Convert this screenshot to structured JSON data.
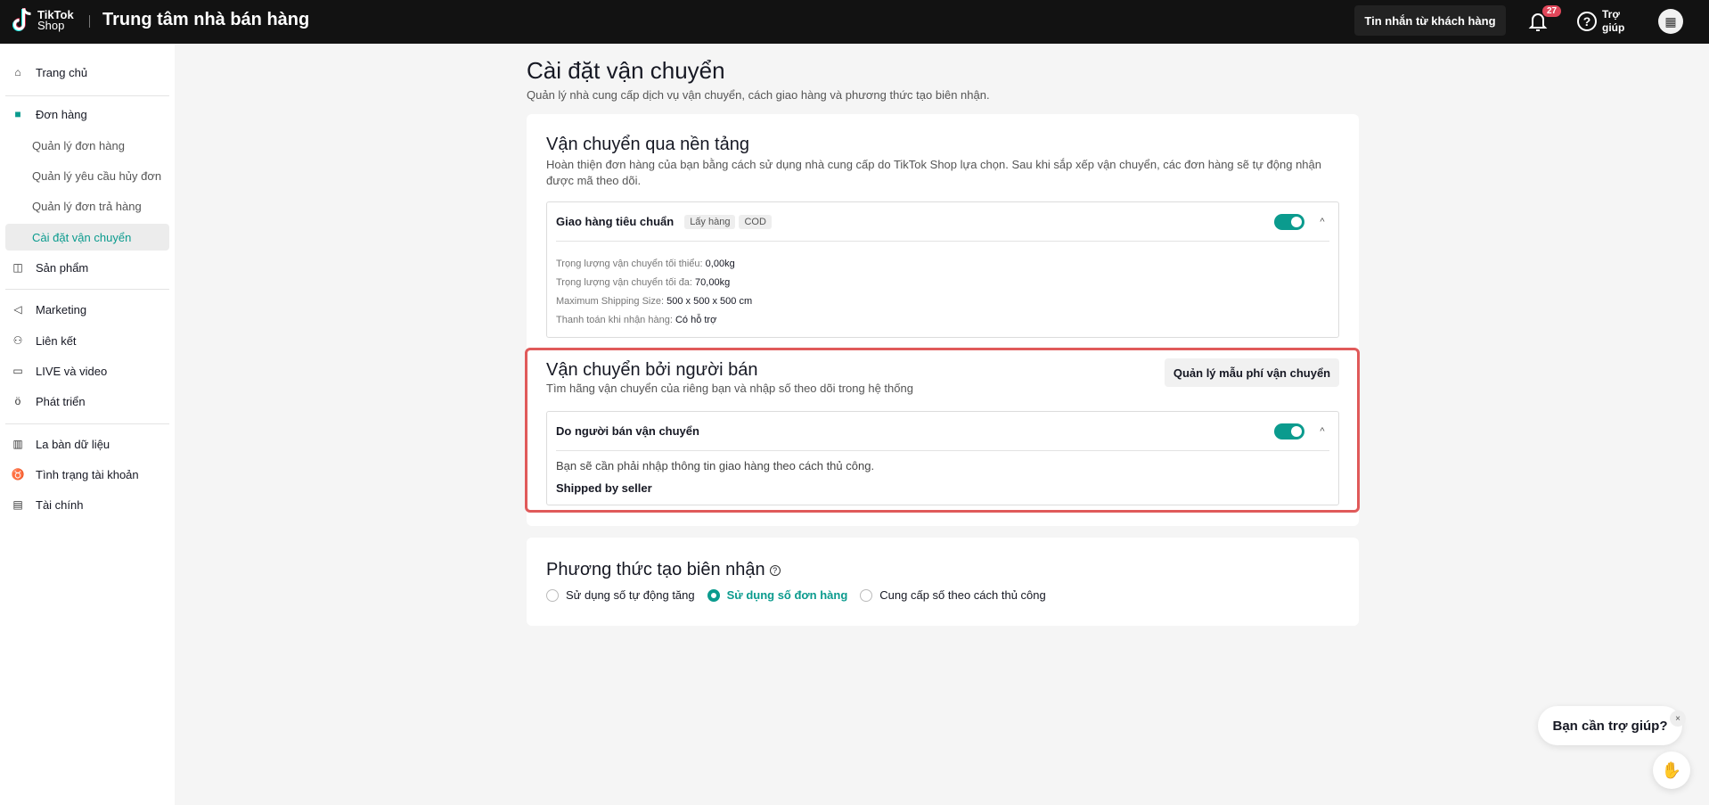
{
  "header": {
    "logo": "TikTok Shop",
    "logo_line1": "TikTok",
    "logo_line2": "Shop",
    "title": "Trung tâm nhà bán hàng",
    "messages_button": "Tin nhắn từ khách hàng",
    "notification_count": "27",
    "help_label": "Trợ giúp"
  },
  "sidebar": {
    "items": [
      {
        "label": "Trang chủ",
        "icon": "home-icon"
      },
      {
        "label": "Đơn hàng",
        "icon": "order-icon"
      },
      {
        "label": "Quản lý đơn hàng"
      },
      {
        "label": "Quản lý yêu cầu hủy đơn"
      },
      {
        "label": "Quản lý đơn trả hàng"
      },
      {
        "label": "Cài đặt vận chuyển",
        "active": true
      },
      {
        "label": "Sản phẩm",
        "icon": "product-icon"
      },
      {
        "label": "Marketing",
        "icon": "megaphone-icon"
      },
      {
        "label": "Liên kết",
        "icon": "users-icon"
      },
      {
        "label": "LIVE và video",
        "icon": "video-icon"
      },
      {
        "label": "Phát triển",
        "icon": "growth-icon"
      },
      {
        "label": "La bàn dữ liệu",
        "icon": "chart-icon"
      },
      {
        "label": "Tình trạng tài khoản",
        "icon": "trophy-icon"
      },
      {
        "label": "Tài chính",
        "icon": "wallet-icon"
      }
    ]
  },
  "page": {
    "title": "Cài đặt vận chuyển",
    "subtitle": "Quản lý nhà cung cấp dịch vụ vận chuyển, cách giao hàng và phương thức tạo biên nhận."
  },
  "platform": {
    "title": "Vận chuyển qua nền tảng",
    "desc": "Hoàn thiện đơn hàng của bạn bằng cách sử dụng nhà cung cấp do TikTok Shop lựa chọn. Sau khi sắp xếp vận chuyển, các đơn hàng sẽ tự động nhận được mã theo dõi.",
    "option": {
      "name": "Giao hàng tiêu chuẩn",
      "tags": [
        "Lấy hàng",
        "COD"
      ],
      "enabled": true,
      "details": [
        {
          "label": "Trọng lượng vận chuyển tối thiểu:",
          "value": "0,00kg"
        },
        {
          "label": "Trọng lượng vận chuyển tối đa:",
          "value": "70,00kg"
        },
        {
          "label": "Maximum Shipping Size:",
          "value": "500 x 500 x 500 cm"
        },
        {
          "label": "Thanh toán khi nhận hàng:",
          "value": "Có hỗ trợ"
        }
      ]
    }
  },
  "seller": {
    "title": "Vận chuyển bởi người bán",
    "desc": "Tìm hãng vận chuyển của riêng bạn và nhập số theo dõi trong hệ thống",
    "button": "Quản lý mẫu phí vận chuyển",
    "option": {
      "name": "Do người bán vận chuyển",
      "enabled": true,
      "note": "Bạn sẽ cần phải nhập thông tin giao hàng theo cách thủ công.",
      "label": "Shipped by seller"
    }
  },
  "receipt": {
    "title": "Phương thức tạo biên nhận",
    "options": [
      "Sử dụng số tự động tăng",
      "Sử dụng số đơn hàng",
      "Cung cấp số theo cách thủ công"
    ],
    "selected": "Sử dụng số đơn hàng"
  },
  "chat": {
    "bubble": "Bạn cần trợ giúp?",
    "close": "×"
  },
  "colors": {
    "accent": "#0b9b8e",
    "highlight": "#e05a5a",
    "header": "#121212"
  }
}
